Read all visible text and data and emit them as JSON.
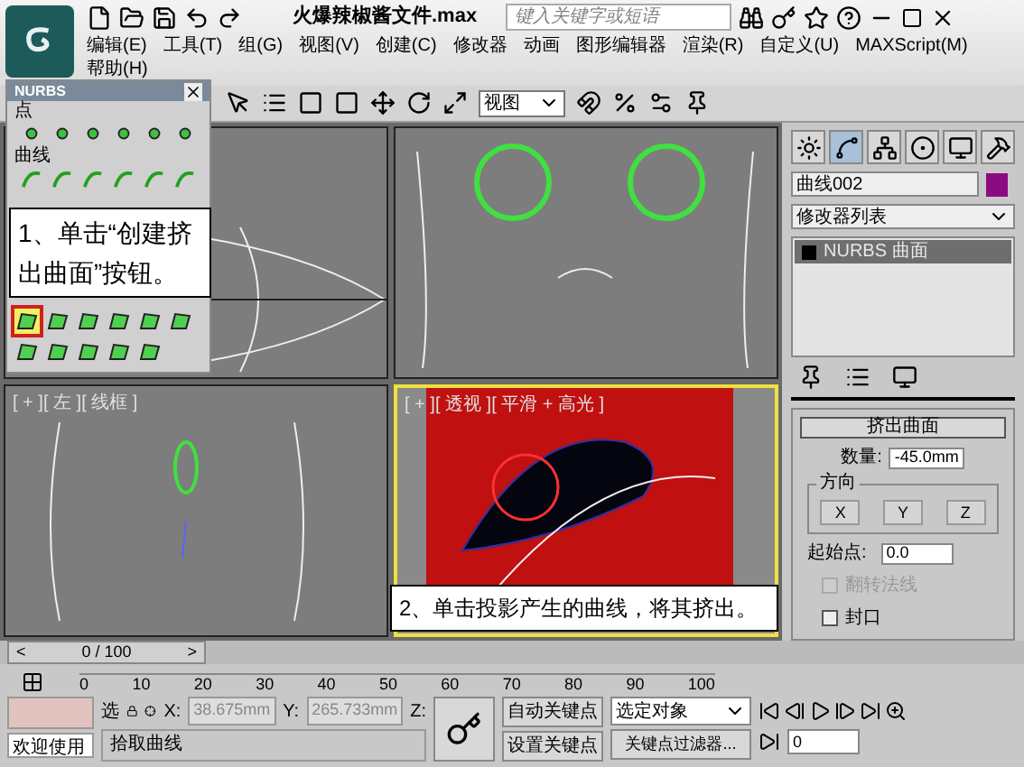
{
  "title_bar": {
    "file_title": "火爆辣椒酱文件.max",
    "search": {
      "placeholder": "键入关键字或短语"
    }
  },
  "menu": [
    "编辑(E)",
    "工具(T)",
    "组(G)",
    "视图(V)",
    "创建(C)",
    "修改器",
    "动画",
    "图形编辑器",
    "渲染(R)",
    "自定义(U)",
    "MAXScript(M)",
    "帮助(H)"
  ],
  "toolbar": {
    "view_dropdown": "视图"
  },
  "nurbs_panel": {
    "title": "NURBS",
    "point_label": "点",
    "curve_label": "曲线",
    "surface_tools": [
      {
        "selected": true
      },
      {
        "selected": false
      },
      {
        "selected": false
      },
      {
        "selected": false
      },
      {
        "selected": false
      },
      {
        "selected": false
      },
      {
        "selected": false
      },
      {
        "selected": false
      },
      {
        "selected": false
      },
      {
        "selected": false
      },
      {
        "selected": false
      }
    ]
  },
  "viewports": [
    {
      "kind": "top",
      "active": false
    },
    {
      "kind": "front",
      "active": false
    },
    {
      "kind": "left",
      "active": false,
      "label": "[ + ][ 左 ][ 线框 ]"
    },
    {
      "kind": "perspective",
      "active": true,
      "label": "[ + ][ 透视 ][ 平滑 + 高光 ]"
    }
  ],
  "callouts": [
    "1、单击“创建挤出曲面”按钮。",
    "2、单击投影产生的曲线，将其挤出。"
  ],
  "command_panel": {
    "tabs": [
      {
        "selected": false
      },
      {
        "selected": true
      },
      {
        "selected": false
      },
      {
        "selected": false
      },
      {
        "selected": false
      },
      {
        "selected": false
      }
    ],
    "object_name": "曲线002",
    "modifier_list": "修改器列表",
    "stack": [
      {
        "label": "NURBS 曲面",
        "selected": true
      }
    ],
    "rollout": {
      "title": "挤出曲面",
      "amount_label": "数量:",
      "amount": "-45.0mm",
      "direction_label": "方向",
      "axes": [
        "X",
        "Y",
        "Z"
      ],
      "start_label": "起始点:",
      "start": "0.0",
      "options": [
        {
          "label": "翻转法线",
          "checked": false,
          "disabled": true
        },
        {
          "label": "封口",
          "checked": false,
          "disabled": false
        }
      ]
    }
  },
  "time_slider": {
    "level": 0,
    "frame": "0 / 100",
    "prev": "<",
    "next": ">"
  },
  "ruler_ticks": [
    "0",
    "10",
    "20",
    "30",
    "40",
    "50",
    "60",
    "70",
    "80",
    "90",
    "100"
  ],
  "status": {
    "welcome": "欢迎使用",
    "select": "选",
    "x_label": "X:",
    "x": "38.675mm",
    "y_label": "Y:",
    "y": "265.733mm",
    "z_label": "Z:",
    "prompt": "拾取曲线",
    "auto_key": "自动关键点",
    "set_key": "设置关键点",
    "selection": "选定对象",
    "key_filters": "关键点过滤器...",
    "frame": "0"
  }
}
